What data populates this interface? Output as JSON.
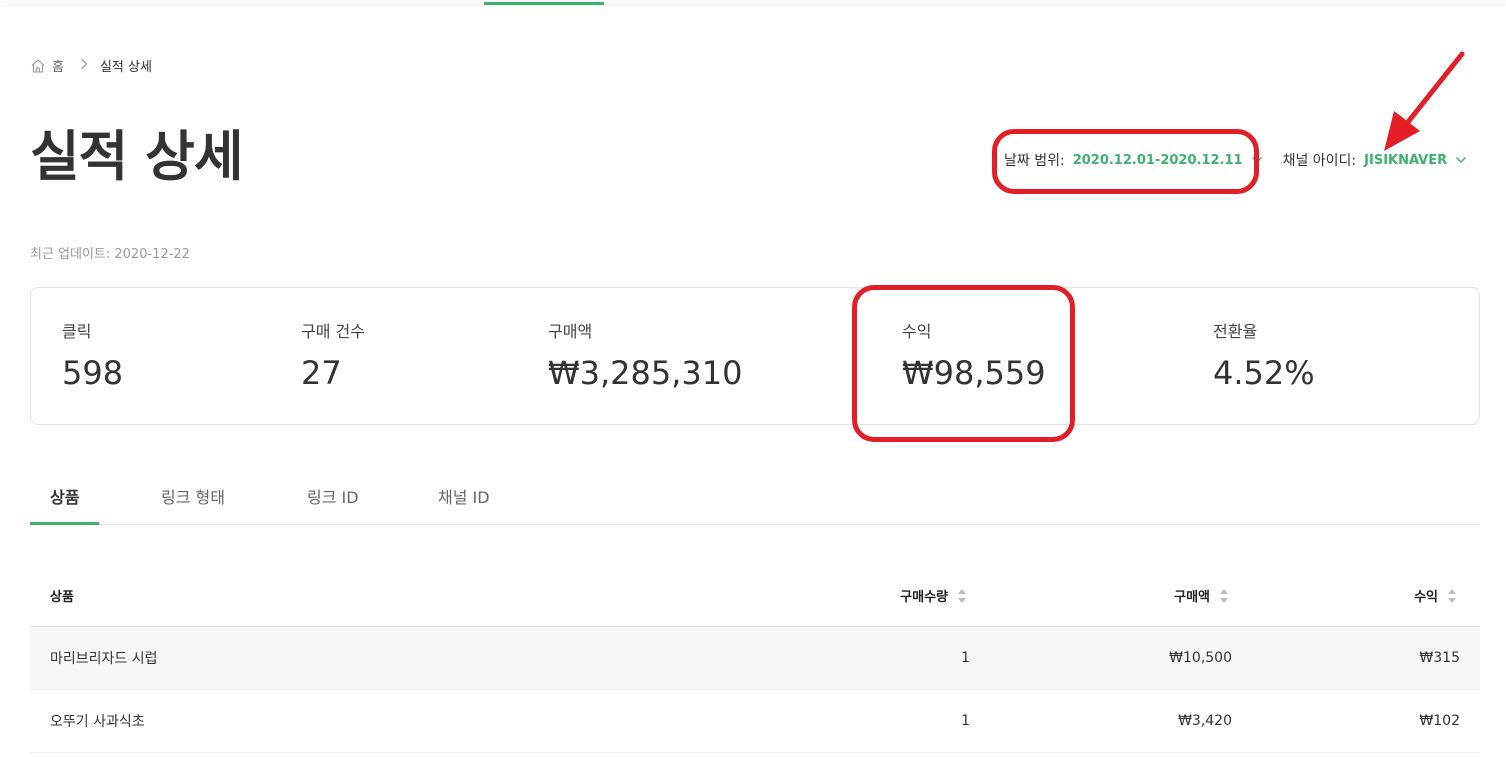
{
  "breadcrumb": {
    "home": "홈",
    "current": "실적 상세"
  },
  "page_title": "실적 상세",
  "filters": {
    "date_label": "날짜 범위:",
    "date_value": "2020.12.01-2020.12.11",
    "channel_label": "채널 아이디:",
    "channel_value": "JISIKNAVER"
  },
  "updated": "최근 업데이트: 2020-12-22",
  "stats": [
    {
      "label": "클릭",
      "value": "598"
    },
    {
      "label": "구매 건수",
      "value": "27"
    },
    {
      "label": "구매액",
      "value": "₩3,285,310"
    },
    {
      "label": "수익",
      "value": "₩98,559"
    },
    {
      "label": "전환율",
      "value": "4.52%"
    }
  ],
  "tabs": [
    {
      "label": "상품",
      "active": true
    },
    {
      "label": "링크 형태",
      "active": false
    },
    {
      "label": "링크 ID",
      "active": false
    },
    {
      "label": "채널 ID",
      "active": false
    }
  ],
  "table": {
    "headers": {
      "product": "상품",
      "quantity": "구매수량",
      "amount": "구매액",
      "revenue": "수익"
    },
    "rows": [
      {
        "product": "마리브리자드 시럽",
        "quantity": "1",
        "amount": "₩10,500",
        "revenue": "₩315"
      },
      {
        "product": "오뚜기 사과식초",
        "quantity": "1",
        "amount": "₩3,420",
        "revenue": "₩102"
      }
    ]
  },
  "colors": {
    "accent": "#3eb16c",
    "annotation": "#e31e26"
  },
  "icons": {
    "home": "home-icon",
    "chevron": "chevron-down-icon",
    "sort": "sort-icon"
  }
}
